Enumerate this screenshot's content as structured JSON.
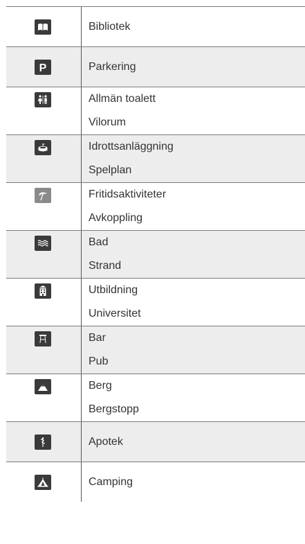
{
  "rows": [
    {
      "icon": "book-icon",
      "style": "dark",
      "labels": [
        "Bibliotek"
      ]
    },
    {
      "icon": "parking-icon",
      "style": "dark",
      "labels": [
        "Parkering"
      ]
    },
    {
      "icon": "toilet-icon",
      "style": "dark",
      "labels": [
        "Allmän toalett",
        "Vilorum"
      ]
    },
    {
      "icon": "stadium-icon",
      "style": "dark",
      "labels": [
        "Idrottsanläggning",
        "Spelplan"
      ]
    },
    {
      "icon": "beach-umbrella-icon",
      "style": "gray",
      "labels": [
        "Fritidsaktiviteter",
        "Avkoppling"
      ]
    },
    {
      "icon": "waves-icon",
      "style": "dark",
      "labels": [
        "Bad",
        "Strand"
      ]
    },
    {
      "icon": "school-building-icon",
      "style": "dark",
      "labels": [
        "Utbildning",
        "Universitet"
      ]
    },
    {
      "icon": "bar-stool-icon",
      "style": "dark",
      "labels": [
        "Bar",
        "Pub"
      ]
    },
    {
      "icon": "mountain-icon",
      "style": "dark",
      "labels": [
        "Berg",
        "Bergstopp"
      ]
    },
    {
      "icon": "pharmacy-icon",
      "style": "dark",
      "labels": [
        "Apotek"
      ]
    },
    {
      "icon": "tent-icon",
      "style": "dark",
      "labels": [
        "Camping"
      ]
    }
  ]
}
